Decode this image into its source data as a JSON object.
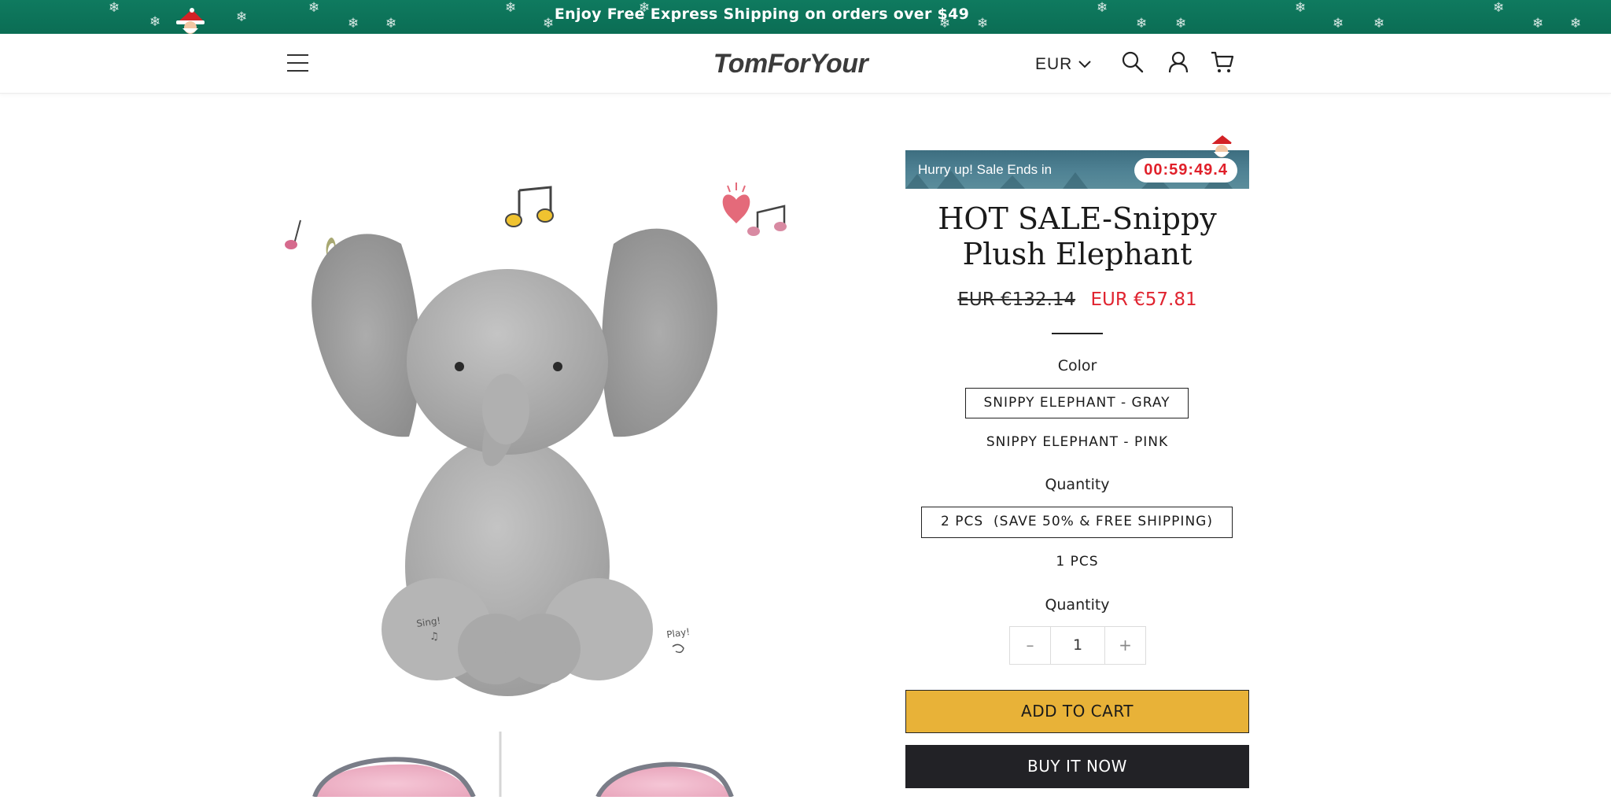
{
  "announcement": {
    "text": "Enjoy Free Express Shipping on orders over $49"
  },
  "header": {
    "logo": "TomForYour",
    "currency": "EUR",
    "icons": [
      "menu-icon",
      "chevron-down-icon",
      "search-icon",
      "user-icon",
      "cart-icon"
    ]
  },
  "timer": {
    "label": "Hurry up! Sale Ends in",
    "value": "00:59:49.4"
  },
  "product": {
    "title_line1": "HOT SALE-Snippy",
    "title_line2": "Plush Elephant",
    "price_original": "EUR €132.14",
    "price_sale": "EUR €57.81",
    "color_label": "Color",
    "colors": [
      "SNIPPY ELEPHANT - GRAY",
      "SNIPPY ELEPHANT - PINK"
    ],
    "quantity_option_label": "Quantity",
    "quantity_options": [
      "2 PCS  (SAVE 50% & FREE SHIPPING)",
      "1 PCS"
    ],
    "quantity_label": "Quantity",
    "quantity_value": "1",
    "quantity_minus": "–",
    "quantity_plus": "+",
    "add_to_cart": "ADD TO CART",
    "buy_now": "BUY IT NOW",
    "paw_left_text": "Sing!",
    "paw_right_text": "Play!"
  },
  "colors": {
    "announcement_bg": "#0b6d54",
    "sale_price": "#e02430",
    "add_to_cart_bg": "#e8b238",
    "buy_now_bg": "#222226",
    "timer_digits": "#e0202a"
  }
}
